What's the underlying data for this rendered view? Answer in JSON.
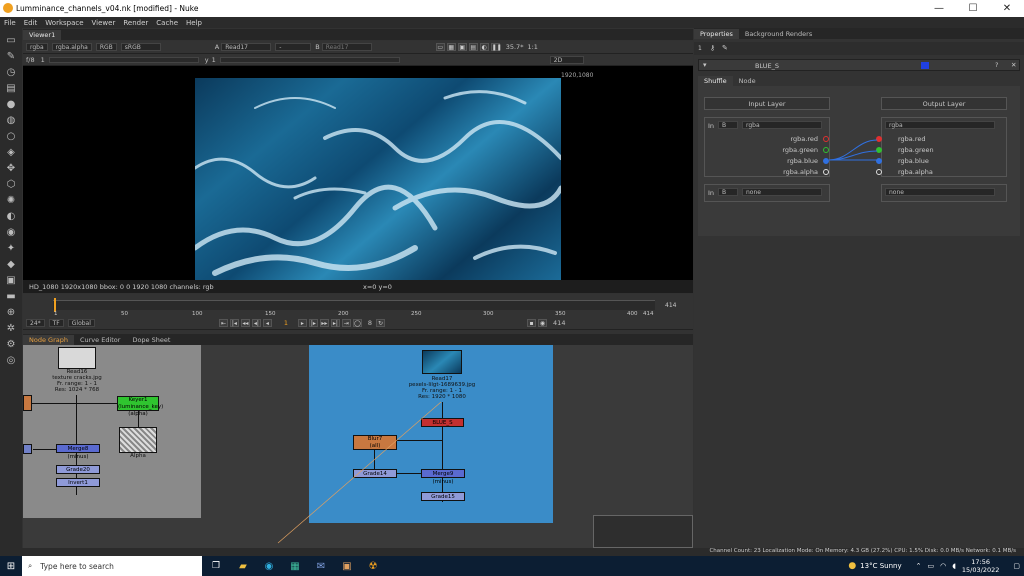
{
  "window": {
    "title": "Lumminance_channels_v04.nk [modified] - Nuke",
    "min": "—",
    "max": "☐",
    "close": "✕"
  },
  "menu": [
    "File",
    "Edit",
    "Workspace",
    "Viewer",
    "Render",
    "Cache",
    "Help"
  ],
  "viewer": {
    "tab": "Viewer1",
    "channels": "rgba",
    "alpha": "rgba.alpha",
    "rgb": "RGB",
    "colorspace": "sRGB",
    "a_label": "A",
    "a_input": "Read17",
    "a_op": "-",
    "b_label": "B",
    "b_input": "Read17",
    "zoom": "35.7*",
    "ratio": "1:1",
    "fstop": "f/8",
    "frame_small": "1",
    "gamma_label": "y",
    "gamma": "1",
    "view_mode": "2D",
    "resolution": "1920,1080",
    "status": "HD_1080 1920x1080  bbox: 0 0 1920 1080 channels: rgb",
    "coords": "x=0 y=0"
  },
  "timeline": {
    "ticks": [
      "1",
      "50",
      "100",
      "150",
      "200",
      "250",
      "300",
      "350",
      "400"
    ],
    "end": "414",
    "end2": "414",
    "fps": "24*",
    "tf": "TF",
    "global": "Global",
    "frame": "1",
    "step": "8",
    "end3": "414"
  },
  "nodegraph": {
    "tabs": [
      "Node Graph",
      "Curve Editor",
      "Dope Sheet"
    ],
    "left": {
      "read16": [
        "Read16",
        "texture cracks.jpg",
        "Fr. range: 1 - 1",
        "Res: 1024 * 768"
      ],
      "keyer": "Keyer1 (luminance_key)",
      "keyer_sub": "(alpha)",
      "merge": "Merge8 (minus)",
      "grade20": "Grade20",
      "invert": "Invert1",
      "alpha": "Alpha"
    },
    "right": {
      "read17": [
        "Read17",
        "pexels-lilgt-1689639.jpg",
        "Fr. range: 1 - 1",
        "Res: 1920 * 1080"
      ],
      "shuffle": "BLUE_S",
      "blur": "Blur7",
      "blur_sub": "(all)",
      "grade14": "Grade14",
      "merge": "Merge9 (minus)",
      "grade15": "Grade15"
    }
  },
  "properties": {
    "tabs": [
      "Properties",
      "Background Renders"
    ],
    "node_name": "BLUE_S",
    "subtabs": [
      "Shuffle",
      "Node"
    ],
    "input_header": "Input Layer",
    "output_header": "Output Layer",
    "in_label": "In",
    "in_b": "B",
    "in_layer": "rgba",
    "out_layer": "rgba",
    "in_channels": [
      "rgba.red",
      "rgba.green",
      "rgba.blue",
      "rgba.alpha"
    ],
    "out_channels": [
      "rgba.red",
      "rgba.green",
      "rgba.blue",
      "rgba.alpha"
    ],
    "in2_label": "In",
    "in2_b": "B",
    "in2_layer": "none",
    "out2_layer": "none"
  },
  "statusbar": "Channel Count: 23  Localization Mode: On  Memory: 4.3 GB (27.2%)  CPU: 1.5%  Disk: 0.0 MB/s  Network: 0.1 MB/s",
  "taskbar": {
    "search": "Type here to search",
    "weather": "13°C  Sunny",
    "time": "17:56",
    "date": "15/03/2022"
  }
}
